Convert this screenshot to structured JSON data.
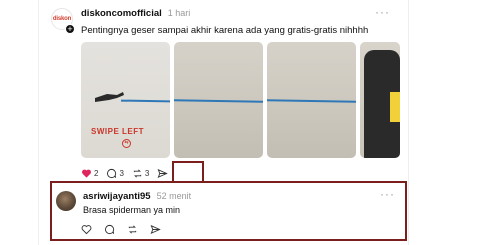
{
  "post": {
    "username": "diskoncomofficial",
    "time": "1 hari",
    "avatar_text": "diskon",
    "caption": "Pentingnya geser sampai akhir karena ada yang gratis-gratis nihhhh",
    "more": "···",
    "slides": {
      "swipe_text": "SWIPE LEFT"
    },
    "likes": "2",
    "comments": "3",
    "reposts": "3"
  },
  "reply": {
    "username": "asriwijayanti95",
    "time": "52 menit",
    "text": "Brasa spiderman ya min",
    "more": "···"
  },
  "colors": {
    "like": "#e0245e",
    "highlight_border": "#7a1e1e",
    "muted": "#999999"
  },
  "icons": [
    "heart-icon",
    "comment-icon",
    "repost-icon",
    "share-icon",
    "more-icon",
    "plus-icon"
  ]
}
